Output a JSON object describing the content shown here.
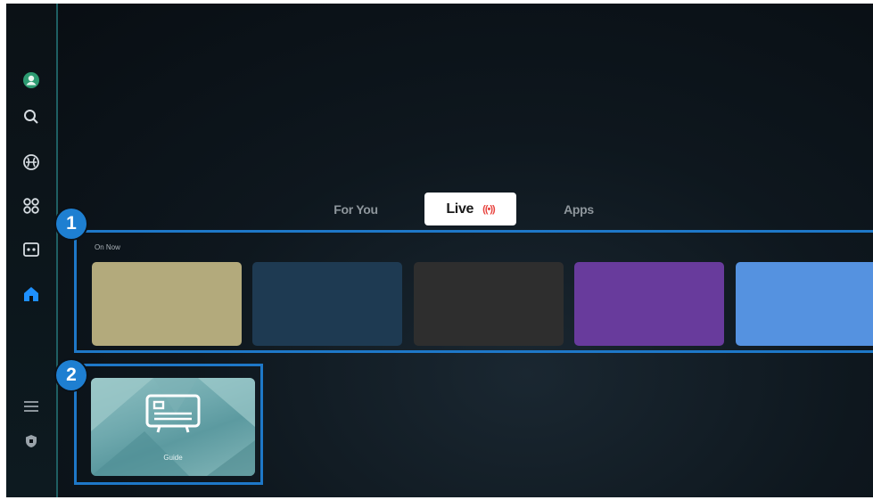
{
  "sidebar": {
    "items": [
      {
        "icon": "profile-icon"
      },
      {
        "icon": "search-icon"
      },
      {
        "icon": "ambient-icon"
      },
      {
        "icon": "apps-grid-icon"
      },
      {
        "icon": "game-icon"
      },
      {
        "icon": "home-icon",
        "active": true
      },
      {
        "icon": "menu-icon"
      },
      {
        "icon": "privacy-icon"
      }
    ]
  },
  "tabs": [
    {
      "label": "For You"
    },
    {
      "label": "Live",
      "indicator": "((•))",
      "active": true
    },
    {
      "label": "Apps"
    }
  ],
  "markers": [
    "1",
    "2"
  ],
  "live_section": {
    "label": "On Now",
    "cards": [
      {
        "color": "#b3aa7c"
      },
      {
        "color": "#1e3a52"
      },
      {
        "color": "#2e2e2e"
      },
      {
        "color": "#683b9c"
      },
      {
        "color": "#5592e0"
      }
    ]
  },
  "guide_section": {
    "label": "Guide",
    "icon": "tv-guide-icon"
  },
  "colors": {
    "accent": "#1e7fd1",
    "sidebar_active": "#1e90ff",
    "live_indicator": "#e8443f"
  }
}
